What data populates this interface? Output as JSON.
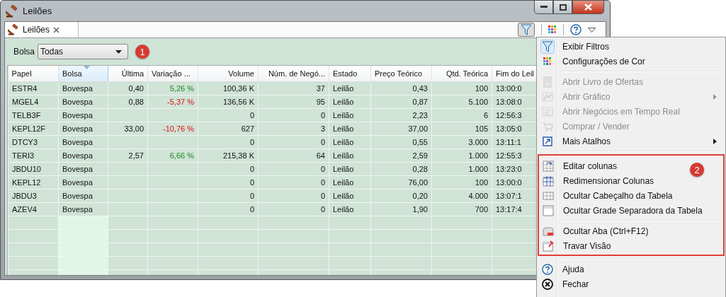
{
  "window": {
    "title": "Leilões"
  },
  "tabs": [
    {
      "label": "Leilões",
      "selected": true
    }
  ],
  "toolbar": {
    "filter_pressed": true
  },
  "filter": {
    "label": "Bolsa",
    "value": "Todas",
    "badge": "1"
  },
  "table": {
    "columns": [
      {
        "label": "Papel",
        "sorted": false
      },
      {
        "label": "Bolsa",
        "sorted": true
      },
      {
        "label": "Última",
        "sorted": false
      },
      {
        "label": "Variação ...",
        "sorted": false
      },
      {
        "label": "Volume",
        "sorted": false
      },
      {
        "label": "Núm. de Negó...",
        "sorted": false
      },
      {
        "label": "Estado",
        "sorted": false
      },
      {
        "label": "Preço Teórico",
        "sorted": false
      },
      {
        "label": "Qtd. Teórica",
        "sorted": false
      },
      {
        "label": "Fim do Leil",
        "sorted": false
      }
    ],
    "rows": [
      {
        "papel": "ESTR4",
        "bolsa": "Bovespa",
        "ultima": "0,40",
        "variacao": {
          "text": "5,26 %",
          "negative": false
        },
        "volume": "100,36 K",
        "negocios": "37",
        "estado": "Leilão",
        "preco_teorico": "0,43",
        "qtd_teorica": "100",
        "fim_do_leilao": "13:00:0"
      },
      {
        "papel": "MGEL4",
        "bolsa": "Bovespa",
        "ultima": "0,88",
        "variacao": {
          "text": "-5,37 %",
          "negative": true
        },
        "volume": "136,56 K",
        "negocios": "95",
        "estado": "Leilão",
        "preco_teorico": "0,87",
        "qtd_teorica": "5.100",
        "fim_do_leilao": "13:08:0"
      },
      {
        "papel": "TELB3F",
        "bolsa": "Bovespa",
        "volume": "0",
        "negocios": "0",
        "estado": "Leilão",
        "preco_teorico": "2,23",
        "qtd_teorica": "6",
        "fim_do_leilao": "12:56:3"
      },
      {
        "papel": "KEPL12F",
        "bolsa": "Bovespa",
        "ultima": "33,00",
        "variacao": {
          "text": "-10,76 %",
          "negative": true
        },
        "volume": "627",
        "negocios": "3",
        "estado": "Leilão",
        "preco_teorico": "37,00",
        "qtd_teorica": "105",
        "fim_do_leilao": "13:05:0"
      },
      {
        "papel": "DTCY3",
        "bolsa": "Bovespa",
        "volume": "0",
        "negocios": "0",
        "estado": "Leilão",
        "preco_teorico": "0,55",
        "qtd_teorica": "3.000",
        "fim_do_leilao": "13:11:1"
      },
      {
        "papel": "TERI3",
        "bolsa": "Bovespa",
        "ultima": "2,57",
        "variacao": {
          "text": "6,66 %",
          "negative": false
        },
        "volume": "215,38 K",
        "negocios": "64",
        "estado": "Leilão",
        "preco_teorico": "2,59",
        "qtd_teorica": "1.000",
        "fim_do_leilao": "12:55:3"
      },
      {
        "papel": "JBDU10",
        "bolsa": "Bovespa",
        "volume": "0",
        "negocios": "0",
        "estado": "Leilão",
        "preco_teorico": "0,28",
        "qtd_teorica": "1.000",
        "fim_do_leilao": "13:23:0"
      },
      {
        "papel": "KEPL12",
        "bolsa": "Bovespa",
        "volume": "0",
        "negocios": "0",
        "estado": "Leilão",
        "preco_teorico": "76,00",
        "qtd_teorica": "100",
        "fim_do_leilao": "13:00:0"
      },
      {
        "papel": "JBDU3",
        "bolsa": "Bovespa",
        "volume": "0",
        "negocios": "0",
        "estado": "Leilão",
        "preco_teorico": "0,20",
        "qtd_teorica": "4.000",
        "fim_do_leilao": "13:07:1"
      },
      {
        "papel": "AZEV4",
        "bolsa": "Bovespa",
        "volume": "0",
        "negocios": "0",
        "estado": "Leilão",
        "preco_teorico": "1,90",
        "qtd_teorica": "700",
        "fim_do_leilao": "13:17:4"
      }
    ]
  },
  "context_menu": {
    "blocks": [
      {
        "highlighted": false,
        "sections": [
          [
            {
              "label": "Exibir Filtros",
              "checked": true,
              "disabled": false,
              "submenu": false
            },
            {
              "label": "Configurações de Cor",
              "checked": false,
              "disabled": false,
              "submenu": false
            }
          ],
          [
            {
              "label": "Abrir Livro de Ofertas",
              "checked": false,
              "disabled": true,
              "submenu": false
            },
            {
              "label": "Abrir Gráfico",
              "checked": false,
              "disabled": true,
              "submenu": true
            },
            {
              "label": "Abrir Negócios em Tempo Real",
              "checked": false,
              "disabled": true,
              "submenu": false
            },
            {
              "label": "Comprar / Vender",
              "checked": false,
              "disabled": true,
              "submenu": false
            },
            {
              "label": "Mais Atalhos",
              "checked": false,
              "disabled": false,
              "submenu": true
            }
          ]
        ]
      },
      {
        "highlighted": true,
        "badge": "2",
        "sections": [
          [
            {
              "label": "Editar colunas",
              "checked": false,
              "disabled": false,
              "submenu": false
            },
            {
              "label": "Redimensionar Colunas",
              "checked": false,
              "disabled": false,
              "submenu": false
            },
            {
              "label": "Ocultar Cabeçalho da Tabela",
              "checked": false,
              "disabled": false,
              "submenu": false
            },
            {
              "label": "Ocultar Grade Separadora da Tabela",
              "checked": false,
              "disabled": false,
              "submenu": false
            }
          ],
          [
            {
              "label": "Ocultar Aba (Ctrl+F12)",
              "checked": false,
              "disabled": false,
              "submenu": false
            },
            {
              "label": "Travar Visão",
              "checked": false,
              "disabled": false,
              "submenu": false
            }
          ]
        ]
      },
      {
        "highlighted": false,
        "sections": [
          [
            {
              "label": "Ajuda",
              "checked": false,
              "disabled": false,
              "submenu": false
            },
            {
              "label": "Fechar",
              "checked": false,
              "disabled": false,
              "submenu": false
            }
          ]
        ]
      }
    ]
  }
}
